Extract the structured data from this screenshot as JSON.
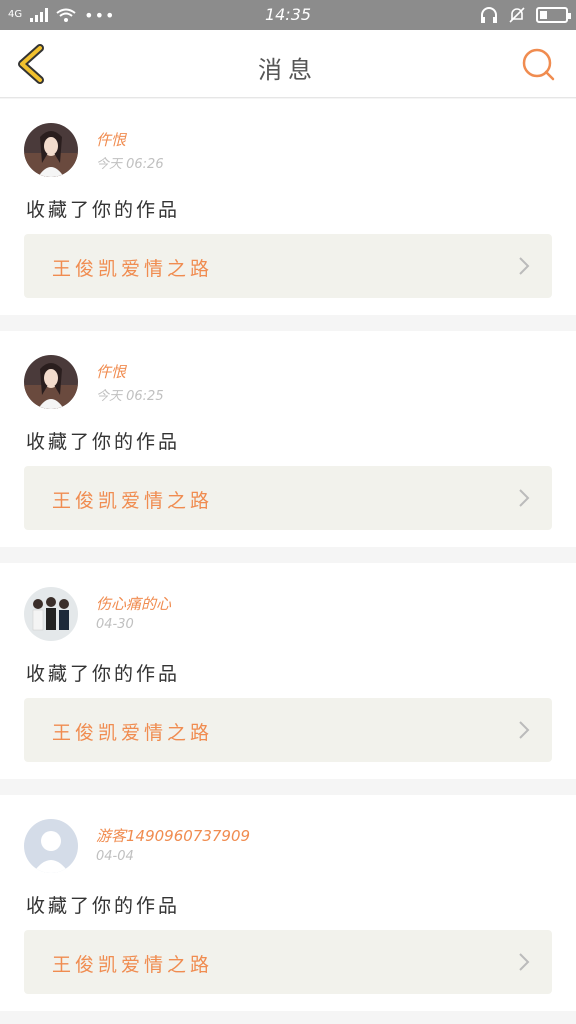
{
  "status_bar": {
    "network": "4G",
    "time": "14:35",
    "dots": "•••",
    "icons": [
      "signal-icon",
      "wifi-icon",
      "headset-icon",
      "mute-icon",
      "battery-icon"
    ],
    "battery_level": 0.3
  },
  "header": {
    "title": "消息",
    "back_icon": "chevron-left-icon",
    "search_icon": "search-icon",
    "accent_color": "#f08c50",
    "back_color": "#f2c12e"
  },
  "messages": [
    {
      "user": "仵恨",
      "time": "今天 06:26",
      "text": "收藏了你的作品",
      "work": "王俊凯爱情之路",
      "avatar": "girl-portrait"
    },
    {
      "user": "仵恨",
      "time": "今天 06:25",
      "text": "收藏了你的作品",
      "work": "王俊凯爱情之路",
      "avatar": "girl-portrait"
    },
    {
      "user": "伤心痛的心",
      "time": "04-30",
      "text": "收藏了你的作品",
      "work": "王俊凯爱情之路",
      "avatar": "group-photo"
    },
    {
      "user": "游客1490960737909",
      "time": "04-04",
      "text": "收藏了你的作品",
      "work": "王俊凯爱情之路",
      "avatar": "default-avatar"
    }
  ]
}
